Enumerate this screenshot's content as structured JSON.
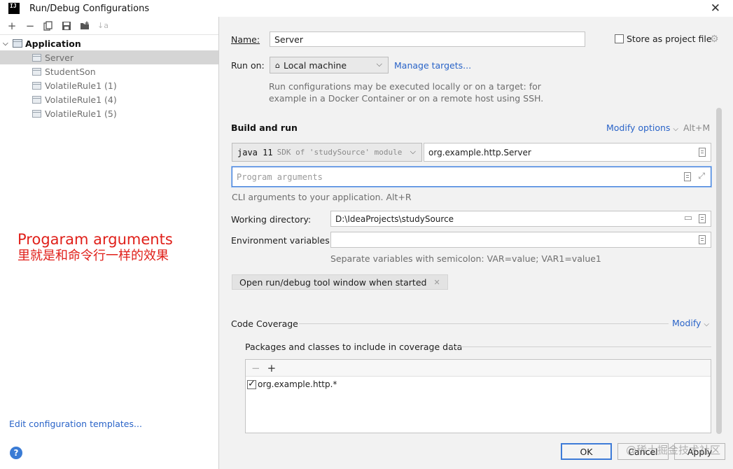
{
  "window": {
    "title": "Run/Debug Configurations",
    "close_glyph": "✕",
    "app_icon_text": "IJ"
  },
  "toolbar": {
    "add": "+",
    "remove": "−",
    "sort": "↓a"
  },
  "tree": {
    "group_label": "Application",
    "items": [
      "Server",
      "StudentSon",
      "VolatileRule1 (1)",
      "VolatileRule1 (4)",
      "VolatileRule1 (5)"
    ]
  },
  "annotation": {
    "line1": "Progaram arguments",
    "line2": "里就是和命令行一样的效果"
  },
  "left_footer": {
    "edit_templates": "Edit configuration templates...",
    "help": "?"
  },
  "form": {
    "name_label": "Name:",
    "name_value": "Server",
    "store_label": "Store as project file",
    "run_on_label": "Run on:",
    "run_on_value": "Local machine",
    "manage_targets": "Manage targets...",
    "run_on_hint_1": "Run configurations may be executed locally or on a target: for",
    "run_on_hint_2": "example in a Docker Container or on a remote host using SSH.",
    "build_run_title": "Build and run",
    "modify_options": "Modify options",
    "modify_shortcut": "Alt+M",
    "jdk_main": "java 11",
    "jdk_sub": "SDK of 'studySource' module",
    "main_class": "org.example.http.Server",
    "program_args_placeholder": "Program arguments",
    "cli_hint": "CLI arguments to your application. Alt+R",
    "workdir_label": "Working directory:",
    "workdir_value": "D:\\IdeaProjects\\studySource",
    "env_label": "Environment variables:",
    "env_value": "",
    "env_hint": "Separate variables with semicolon: VAR=value; VAR1=value1",
    "open_tool_window": "Open run/debug tool window when started",
    "code_coverage_title": "Code Coverage",
    "modify": "Modify",
    "coverage_desc": "Packages and classes to include in coverage data",
    "coverage_items": [
      "org.example.http.*"
    ]
  },
  "buttons": {
    "ok": "OK",
    "cancel": "Cancel",
    "apply": "Apply"
  },
  "watermark": "@稀土掘金技术社区"
}
